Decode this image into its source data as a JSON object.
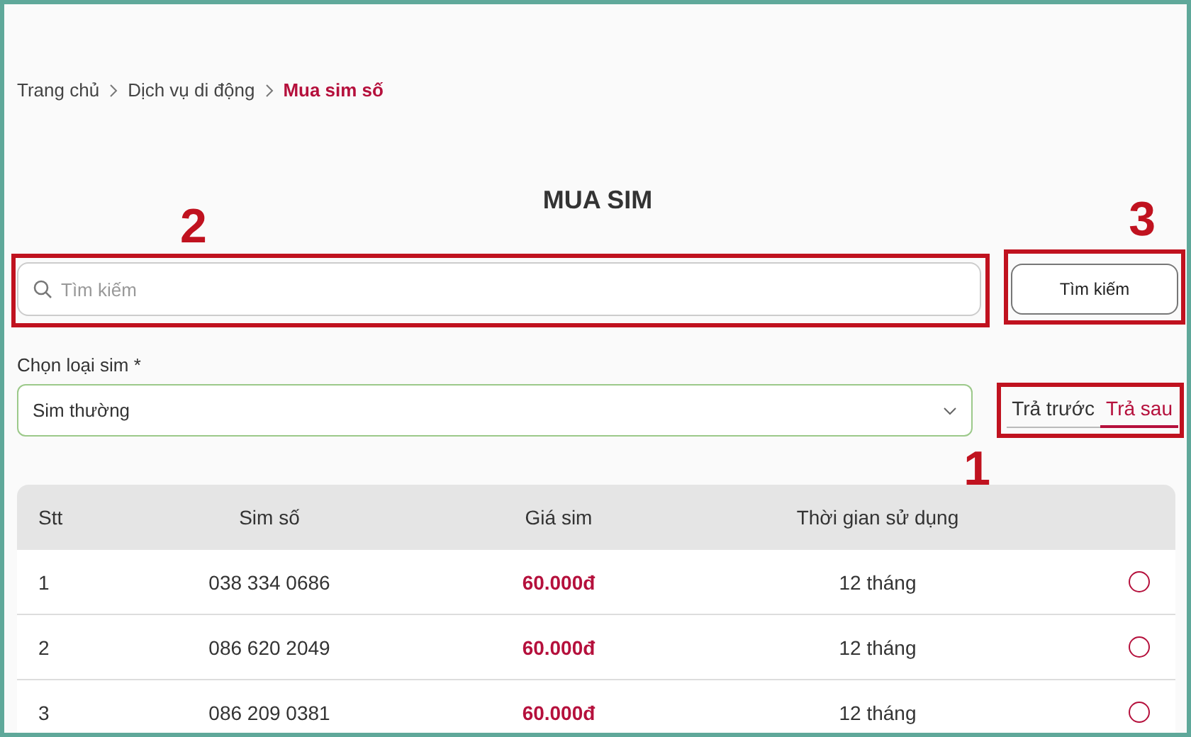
{
  "breadcrumb": [
    {
      "label": "Trang chủ",
      "current": false
    },
    {
      "label": "Dịch vụ di động",
      "current": false
    },
    {
      "label": "Mua sim số",
      "current": true
    }
  ],
  "title": "MUA SIM",
  "search": {
    "placeholder": "Tìm kiếm",
    "callout": "2"
  },
  "search_button": {
    "label": "Tìm kiếm",
    "callout": "3"
  },
  "sim_type": {
    "label": "Chọn loại sim *",
    "value": "Sim thường"
  },
  "tabs": [
    {
      "label": "Trả trước",
      "selected": false
    },
    {
      "label": "Trả sau",
      "selected": true
    }
  ],
  "tabs_callout": "1",
  "table": {
    "columns": [
      "Stt",
      "Sim số",
      "Giá sim",
      "Thời gian sử dụng"
    ],
    "rows": [
      {
        "stt": "1",
        "number": "038 334 0686",
        "price": "60.000đ",
        "duration": "12 tháng",
        "selected": false
      },
      {
        "stt": "2",
        "number": "086 620 2049",
        "price": "60.000đ",
        "duration": "12 tháng",
        "selected": false
      },
      {
        "stt": "3",
        "number": "086 209 0381",
        "price": "60.000đ",
        "duration": "12 tháng",
        "selected": false
      }
    ]
  }
}
